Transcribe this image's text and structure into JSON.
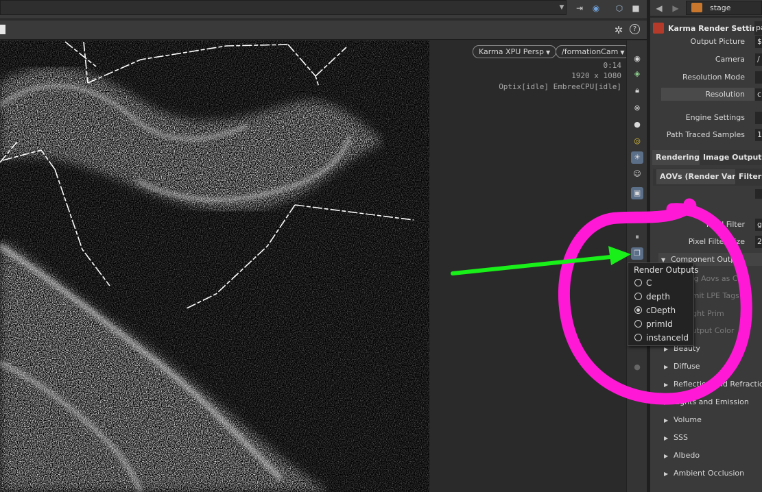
{
  "viewer": {
    "camera_menu": "Karma XPU Persp",
    "camera_path": "/formationCam",
    "time": "0:14",
    "resolution": "1920 x 1080",
    "renderer_status": "Optix[idle] EmbreeCPU[idle]"
  },
  "param_panel": {
    "network": "stage",
    "node_title": "Karma Render Settings",
    "node_title_value": "pa",
    "rows": [
      {
        "label": "Output Picture",
        "value": "$"
      },
      {
        "label": "Camera",
        "value": "/"
      },
      {
        "label": "Resolution Mode",
        "value": ""
      },
      {
        "label": "Resolution",
        "value": "c"
      },
      {
        "label": "Engine Settings",
        "value": ""
      },
      {
        "label": "Path Traced Samples",
        "value": "1"
      }
    ],
    "tabs": [
      "Rendering",
      "Image Output"
    ],
    "subtabs": [
      "AOVs (Render Vars)",
      "Filters"
    ],
    "filter_rows": [
      {
        "label": "Pixel Filter",
        "value": "g"
      },
      {
        "label": "Pixel Filter Size",
        "value": "2"
      }
    ],
    "component_section": "Component Output",
    "component_rows": [
      "Tag Aovs as Cut",
      "Omit LPE Tags",
      "Light Prim",
      "Output Color"
    ],
    "sections": [
      "Beauty",
      "Diffuse",
      "Reflection and Refraction",
      "Lights and Emission",
      "Volume",
      "SSS",
      "Albedo",
      "Ambient Occlusion"
    ]
  },
  "render_outputs": {
    "title": "Render Outputs",
    "options": [
      "C",
      "depth",
      "cDepth",
      "primId",
      "instanceId"
    ],
    "selected": "cDepth"
  },
  "colors": {
    "annotation_circle": "#ff19d6",
    "annotation_arrow": "#19ef19",
    "viewport_bg": "#000000",
    "active_icon": "#5c6f89"
  },
  "icons": {
    "top_toolbar": [
      "pin-icon",
      "snap-icon",
      "cube-icon",
      "square-icon"
    ],
    "nav": [
      "back-arrow-icon",
      "forward-arrow-icon"
    ],
    "viewer_header": [
      "gear-icon",
      "help-icon"
    ],
    "strip": [
      "eye-icon",
      "visibility-icon",
      "lock-icon",
      "xray-icon",
      "sphere-icon",
      "camera-icon",
      "light-icon",
      "skeleton-icon",
      "render-region-icon",
      "pause-icon",
      "render-outputs-icon",
      "dot-icon"
    ]
  }
}
